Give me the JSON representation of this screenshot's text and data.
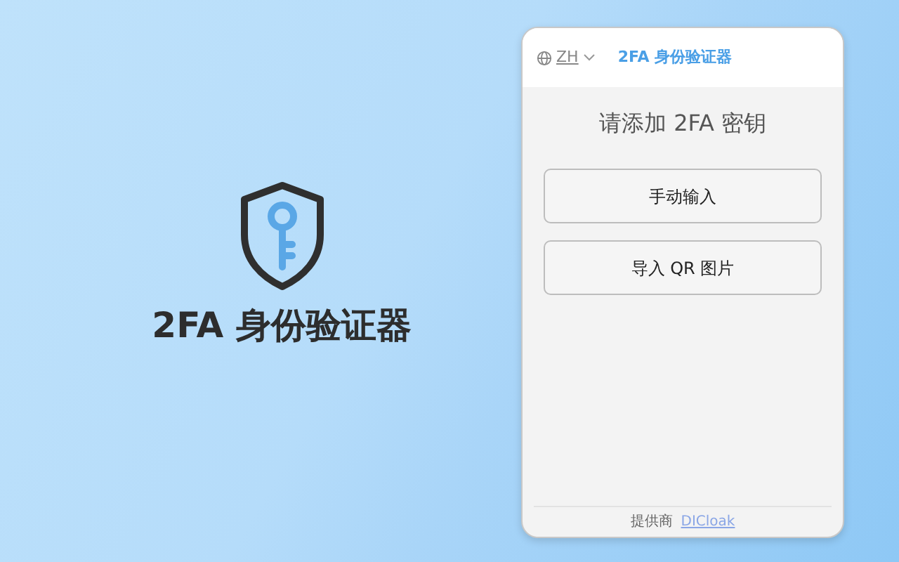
{
  "hero": {
    "title": "2FA 身份验证器"
  },
  "popup": {
    "language": "ZH",
    "app_title": "2FA 身份验证器",
    "heading": "请添加 2FA 密钥",
    "buttons": [
      "手动输入",
      "导入 QR 图片"
    ],
    "footer": {
      "label": "提供商",
      "link": "DICloak"
    }
  }
}
